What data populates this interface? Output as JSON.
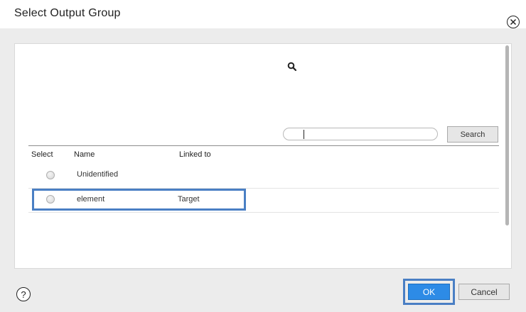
{
  "dialog": {
    "title": "Select Output Group",
    "close_icon": "close-circle-icon",
    "help_icon": "help-circle-icon",
    "help_label": "?"
  },
  "search": {
    "icon": "search-icon",
    "value": "",
    "button_label": "Search"
  },
  "table": {
    "columns": [
      "Select",
      "Name",
      "Linked to"
    ],
    "rows": [
      {
        "name": "Unidentified",
        "linked_to": "",
        "selected": false
      },
      {
        "name": "element",
        "linked_to": "Target",
        "selected": false
      }
    ]
  },
  "footer": {
    "ok_label": "OK",
    "cancel_label": "Cancel"
  },
  "colors": {
    "primary_button": "#2d8be6",
    "highlight_frame": "#4a7fc4"
  }
}
